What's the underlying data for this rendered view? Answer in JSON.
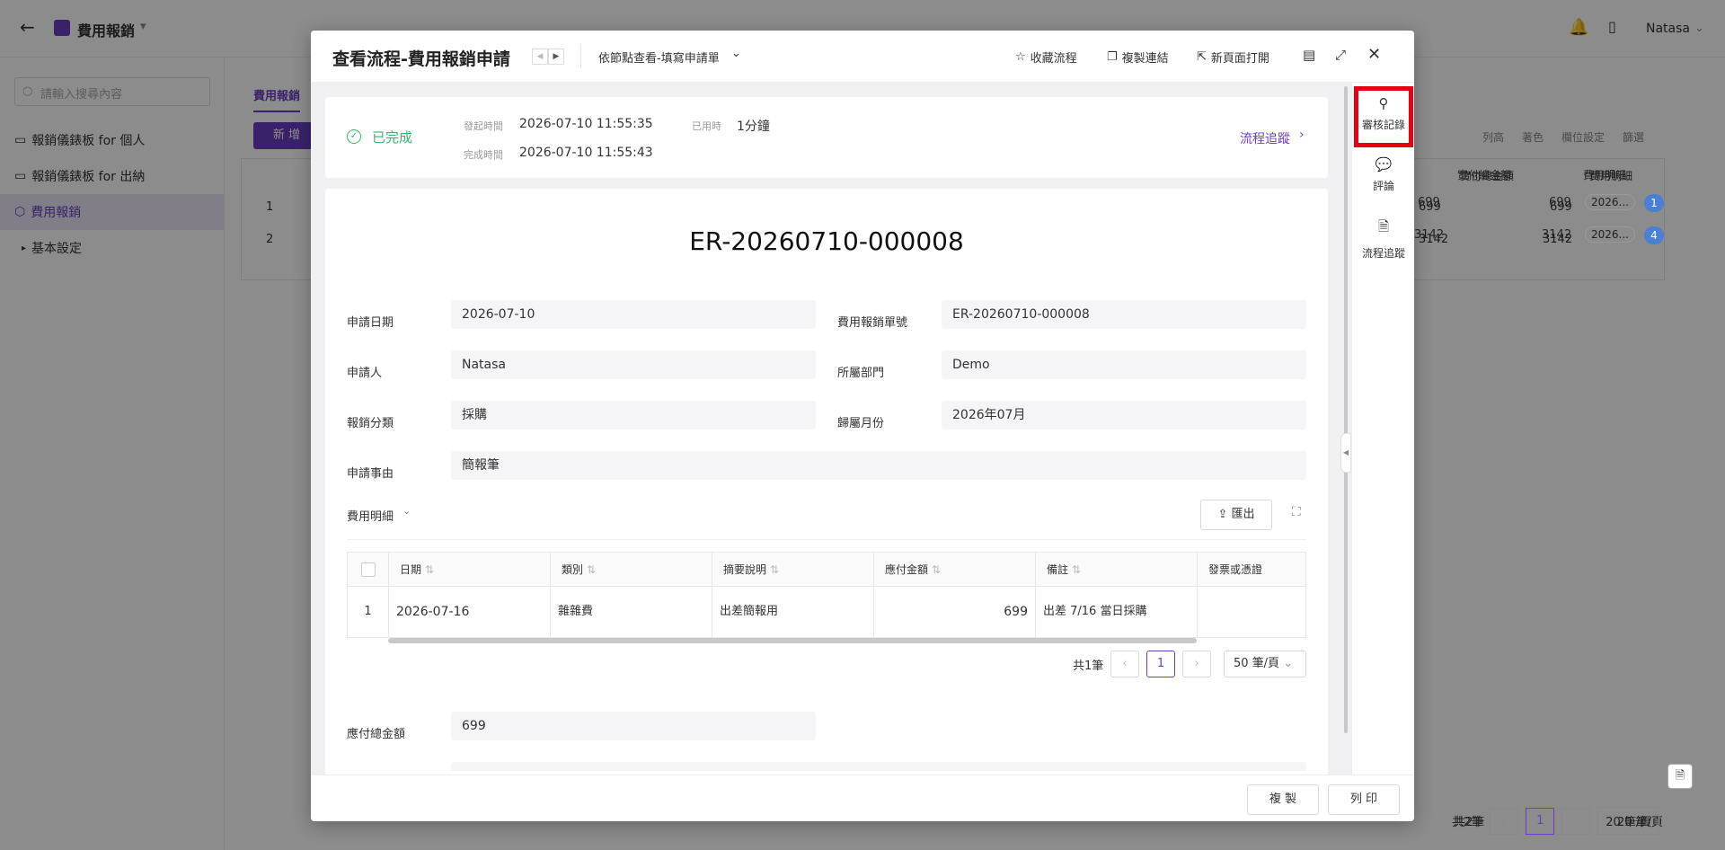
{
  "app": {
    "title": "費用報銷",
    "user": "Natasa"
  },
  "sidebar": {
    "search_placeholder": "請輸入搜尋內容",
    "items": [
      {
        "label": "報銷儀錶板 for 個人"
      },
      {
        "label": "報銷儀錶板 for 出納"
      },
      {
        "label": "費用報銷"
      },
      {
        "label": "基本設定"
      }
    ]
  },
  "bg": {
    "tab": "費用報銷",
    "new_button": "新 增",
    "toolbar": [
      "列高",
      "著色",
      "欄位設定",
      "篩選"
    ],
    "col_headers": [
      "實付總金額",
      "費用明細"
    ],
    "rows": [
      {
        "no": "1",
        "v1": "699",
        "v2": "699",
        "chip": "2026...",
        "badge": "1"
      },
      {
        "no": "2",
        "v1": "3142",
        "v2": "3142",
        "chip": "2026...",
        "badge": "4"
      }
    ],
    "placeholder_row": "--",
    "total": "共2筆",
    "page": "1",
    "page_size": "20 筆/頁"
  },
  "modal": {
    "title": "查看流程-費用報銷申請",
    "view_mode": "依節點查看-填寫申請單",
    "actions": {
      "favorite": "收藏流程",
      "copy_link": "複製連結",
      "new_page": "新頁面打開"
    },
    "status": {
      "label": "已完成",
      "start_label": "發起時間",
      "start_value": "2026-07-10 11:55:35",
      "end_label": "完成時間",
      "end_value": "2026-07-10 11:55:43",
      "used_label": "已用時",
      "used_value": "1分鐘",
      "trace_link": "流程追蹤"
    },
    "doc_title": "ER-20260710-000008",
    "fields": {
      "apply_date": {
        "label": "申請日期",
        "value": "2026-07-10"
      },
      "doc_no": {
        "label": "費用報銷單號",
        "value": "ER-20260710-000008"
      },
      "applicant": {
        "label": "申請人",
        "value": "Natasa"
      },
      "dept": {
        "label": "所屬部門",
        "value": "Demo"
      },
      "category": {
        "label": "報銷分類",
        "value": "採購"
      },
      "month": {
        "label": "歸屬月份",
        "value": "2026年07月"
      },
      "reason": {
        "label": "申請事由",
        "value": "簡報筆"
      }
    },
    "detail": {
      "title": "費用明細",
      "export": "匯出",
      "columns": [
        "日期",
        "類別",
        "摘要說明",
        "應付金額",
        "備註",
        "發票或憑證"
      ],
      "rows": [
        {
          "no": "1",
          "date": "2026-07-16",
          "type": "雜雜費",
          "desc": "出差簡報用",
          "amount": "699",
          "note": "出差 7/16 當日採購",
          "invoice": ""
        }
      ],
      "total": "共1筆",
      "page": "1",
      "page_size": "50 筆/頁"
    },
    "total_payable": {
      "label": "應付總金額",
      "value": "699"
    },
    "rail": [
      "審核記錄",
      "評論",
      "流程追蹤"
    ],
    "footer": {
      "copy": "複 製",
      "print": "列 印"
    }
  },
  "colors": {
    "accent": "#6a3fc1",
    "success": "#3cb371",
    "highlight": "#e60012"
  }
}
